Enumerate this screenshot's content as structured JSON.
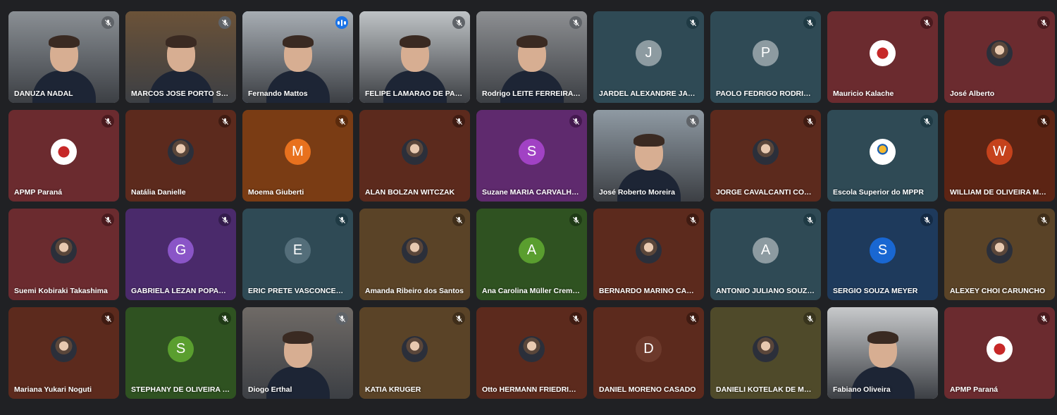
{
  "participants": [
    {
      "name": "DANUZA NADAL",
      "type": "video",
      "bg": "#8a8f94",
      "mic_bg": "#5f6368",
      "muted": true
    },
    {
      "name": "MARCOS JOSE PORTO SOA...",
      "type": "video",
      "bg": "#6b5238",
      "mic_bg": "#5f6368",
      "muted": true
    },
    {
      "name": "Fernando Mattos",
      "type": "video",
      "bg": "#a7adb3",
      "speaking": true
    },
    {
      "name": "FELIPE LAMARAO DE PAUL...",
      "type": "video",
      "bg": "#bfc3c6",
      "mic_bg": "#5f6368",
      "muted": true
    },
    {
      "name": "Rodrigo LEITE FERREIRA CA...",
      "type": "video",
      "bg": "#8d8f92",
      "mic_bg": "#5f6368",
      "muted": true
    },
    {
      "name": "JARDEL ALEXANDRE JAHN",
      "type": "initial",
      "initial": "J",
      "bg": "#2f4a55",
      "avatar_bg": "#8d9ba1",
      "mic_bg": "#1f3a44",
      "muted": true
    },
    {
      "name": "PAOLO FEDRIGO RODRIGU...",
      "type": "initial",
      "initial": "P",
      "bg": "#2f4a55",
      "avatar_bg": "#8d9ba1",
      "mic_bg": "#1f3a44",
      "muted": true
    },
    {
      "name": "Mauricio Kalache",
      "type": "logo",
      "logo": "crest",
      "bg": "#6b2b2f",
      "mic_bg": "#4a1a1e",
      "muted": true
    },
    {
      "name": "José Alberto",
      "type": "photo",
      "bg": "#6b2b2f",
      "mic_bg": "#4a1a1e",
      "muted": true
    },
    {
      "name": "APMP Paraná",
      "type": "logo",
      "logo": "crest",
      "bg": "#6b2b2f",
      "mic_bg": "#4a1a1e",
      "muted": true
    },
    {
      "name": "Natália Danielle",
      "type": "photo",
      "bg": "#5c2a1d",
      "mic_bg": "#3f1b12",
      "muted": true
    },
    {
      "name": "Moema Giuberti",
      "type": "initial",
      "initial": "M",
      "bg": "#7a3c14",
      "avatar_bg": "#e8711e",
      "mic_bg": "#5a2a0c",
      "muted": true
    },
    {
      "name": "ALAN BOLZAN WITCZAK",
      "type": "photo",
      "bg": "#5c2a1d",
      "mic_bg": "#3f1b12",
      "muted": true
    },
    {
      "name": "Suzane MARIA CARVALHO ...",
      "type": "initial",
      "initial": "S",
      "bg": "#5f2a6e",
      "avatar_bg": "#a142c4",
      "mic_bg": "#44194f",
      "muted": true
    },
    {
      "name": "José Roberto Moreira",
      "type": "video",
      "bg": "#8f9aa3",
      "mic_bg": "#5f6368",
      "muted": true
    },
    {
      "name": "JORGE CAVALCANTI COEL...",
      "type": "photo",
      "bg": "#5c2a1d",
      "mic_bg": "#3f1b12",
      "muted": true
    },
    {
      "name": "Escola Superior do MPPR",
      "type": "logo",
      "logo": "school",
      "bg": "#2f4a55",
      "mic_bg": "#1f3a44",
      "muted": true
    },
    {
      "name": "WILLIAM DE OLIVEIRA MORI",
      "type": "initial",
      "initial": "W",
      "bg": "#5c2414",
      "avatar_bg": "#c5421c",
      "mic_bg": "#3f180c",
      "muted": true
    },
    {
      "name": "Suemi Kobiraki Takashima",
      "type": "photo",
      "bg": "#6b2b2f",
      "mic_bg": "#4a1a1e",
      "muted": true
    },
    {
      "name": "GABRIELA LEZAN POPADIUK",
      "type": "initial",
      "initial": "G",
      "bg": "#4a2a6b",
      "avatar_bg": "#8a55c7",
      "mic_bg": "#341c4d",
      "muted": true
    },
    {
      "name": "ERIC PRETE VASCONCELOS",
      "type": "initial",
      "initial": "E",
      "bg": "#2f4a55",
      "avatar_bg": "#546e7a",
      "mic_bg": "#1f3a44",
      "muted": true
    },
    {
      "name": "Amanda Ribeiro dos Santos",
      "type": "photo",
      "bg": "#5a4327",
      "mic_bg": "#3f2e1a",
      "muted": true
    },
    {
      "name": "Ana Carolina Müller Cremo...",
      "type": "initial",
      "initial": "A",
      "bg": "#2f5221",
      "avatar_bg": "#5a9e2f",
      "mic_bg": "#1f3a16",
      "muted": true
    },
    {
      "name": "BERNARDO MARINO CARV...",
      "type": "photo",
      "bg": "#5c2a1d",
      "mic_bg": "#3f1b12",
      "muted": true
    },
    {
      "name": "ANTONIO JULIANO SOUZA ...",
      "type": "initial",
      "initial": "A",
      "bg": "#2f4a55",
      "avatar_bg": "#8d9ba1",
      "mic_bg": "#1f3a44",
      "muted": true
    },
    {
      "name": "SERGIO SOUZA MEYER",
      "type": "initial",
      "initial": "S",
      "bg": "#1e3a5c",
      "avatar_bg": "#1967d2",
      "mic_bg": "#142a44",
      "muted": true
    },
    {
      "name": "ALEXEY CHOI CARUNCHO",
      "type": "photo",
      "bg": "#5a4327",
      "mic_bg": "#3f2e1a",
      "muted": true
    },
    {
      "name": "Mariana Yukari Noguti",
      "type": "photo",
      "bg": "#5c2a1d",
      "mic_bg": "#3f1b12",
      "muted": true
    },
    {
      "name": "STEPHANY DE OLIVEIRA FU...",
      "type": "initial",
      "initial": "S",
      "bg": "#2f5221",
      "avatar_bg": "#5a9e2f",
      "mic_bg": "#1f3a16",
      "muted": true
    },
    {
      "name": "Diogo Erthal",
      "type": "video",
      "bg": "#6f6a66",
      "mic_bg": "#5f6368",
      "muted": true
    },
    {
      "name": "KATIA KRUGER",
      "type": "photo",
      "bg": "#5a4327",
      "mic_bg": "#3f2e1a",
      "muted": true
    },
    {
      "name": "Otto HERMANN FRIEDRICH ...",
      "type": "photo",
      "bg": "#5c2a1d",
      "mic_bg": "#3f1b12",
      "muted": true
    },
    {
      "name": "DANIEL MORENO CASADO",
      "type": "initial",
      "initial": "D",
      "bg": "#5c2a1d",
      "avatar_bg": "#6d3a2c",
      "mic_bg": "#3f1b12",
      "muted": true
    },
    {
      "name": "DANIELI KOTELAK DE MELO",
      "type": "photo",
      "bg": "#4f4a2a",
      "mic_bg": "#38341d",
      "muted": true
    },
    {
      "name": "Fabiano Oliveira",
      "type": "video",
      "bg": "#c7c9cb",
      "mic_bg": "#5f6368",
      "muted": false
    },
    {
      "name": "APMP Paraná",
      "type": "logo",
      "logo": "crest",
      "bg": "#6b2b2f",
      "mic_bg": "#4a1a1e",
      "muted": true
    }
  ],
  "icons": {
    "mic_off": "mic-off-icon",
    "speaking": "audio-level-icon"
  }
}
